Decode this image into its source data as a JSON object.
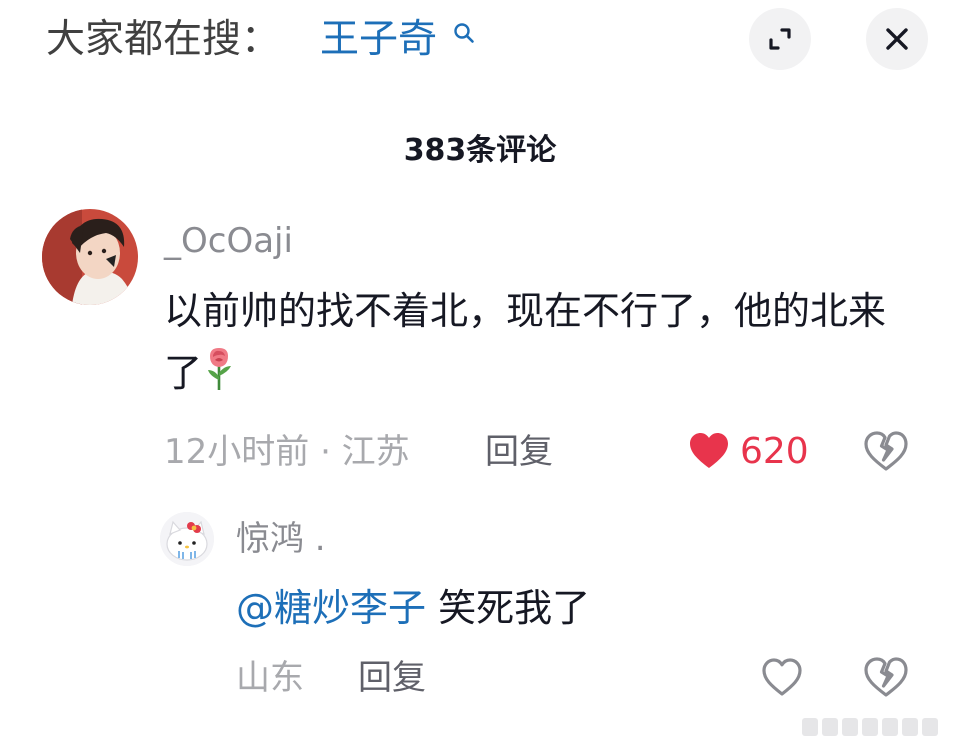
{
  "top_bar": {
    "search_prefix": "大家都在搜：",
    "search_term": "王子奇",
    "icons": [
      "search-icon",
      "expand-icon",
      "close-icon"
    ]
  },
  "comments_header": {
    "title": "383条评论"
  },
  "main_comment": {
    "username": "_OcOaji",
    "text": "以前帅的找不着北，现在不行了，他的北来了",
    "emoji": "rose-icon",
    "time_location": "12小时前 · 江苏",
    "reply_label": "回复",
    "like_count": "620",
    "liked": true
  },
  "reply_comment": {
    "username": "惊鸿 .",
    "mention": "@糖炒李子",
    "text": " 笑死我了",
    "location": "山东",
    "reply_label": "回复",
    "liked": false
  },
  "colors": {
    "link": "#1d6fb8",
    "like": "#e8344c",
    "muted": "#a8a9ad"
  }
}
